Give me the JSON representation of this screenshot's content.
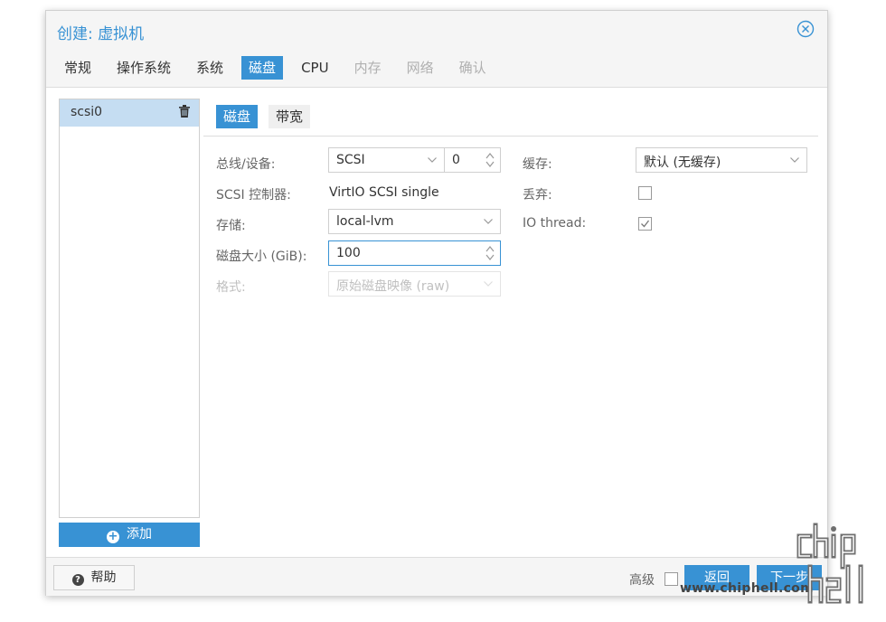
{
  "dialog": {
    "title": "创建: 虚拟机",
    "tabs": [
      {
        "label": "常规",
        "state": "normal"
      },
      {
        "label": "操作系统",
        "state": "normal"
      },
      {
        "label": "系统",
        "state": "normal"
      },
      {
        "label": "磁盘",
        "state": "active"
      },
      {
        "label": "CPU",
        "state": "normal"
      },
      {
        "label": "内存",
        "state": "disabled"
      },
      {
        "label": "网络",
        "state": "disabled"
      },
      {
        "label": "确认",
        "state": "disabled"
      }
    ]
  },
  "sidebar": {
    "items": [
      {
        "label": "scsi0"
      }
    ],
    "add_label": "添加"
  },
  "subtabs": [
    {
      "label": "磁盘",
      "state": "active"
    },
    {
      "label": "带宽",
      "state": "normal"
    }
  ],
  "form": {
    "bus_label": "总线/设备:",
    "bus_value": "SCSI",
    "device_value": "0",
    "controller_label": "SCSI 控制器:",
    "controller_value": "VirtIO SCSI single",
    "storage_label": "存储:",
    "storage_value": "local-lvm",
    "size_label": "磁盘大小 (GiB):",
    "size_value": "100",
    "format_label": "格式:",
    "format_value": "原始磁盘映像 (raw)",
    "cache_label": "缓存:",
    "cache_value": "默认 (无缓存)",
    "discard_label": "丢弃:",
    "discard_checked": false,
    "iothread_label": "IO thread:",
    "iothread_checked": true
  },
  "footer": {
    "help_label": "帮助",
    "advanced_label": "高级",
    "advanced_checked": false,
    "back_label": "返回",
    "next_label": "下一步"
  },
  "watermark": {
    "url": "www.chiphell.com",
    "logo_text": "chip hell"
  },
  "colors": {
    "accent": "#3892d4",
    "selected_row": "#c5ddf2"
  }
}
